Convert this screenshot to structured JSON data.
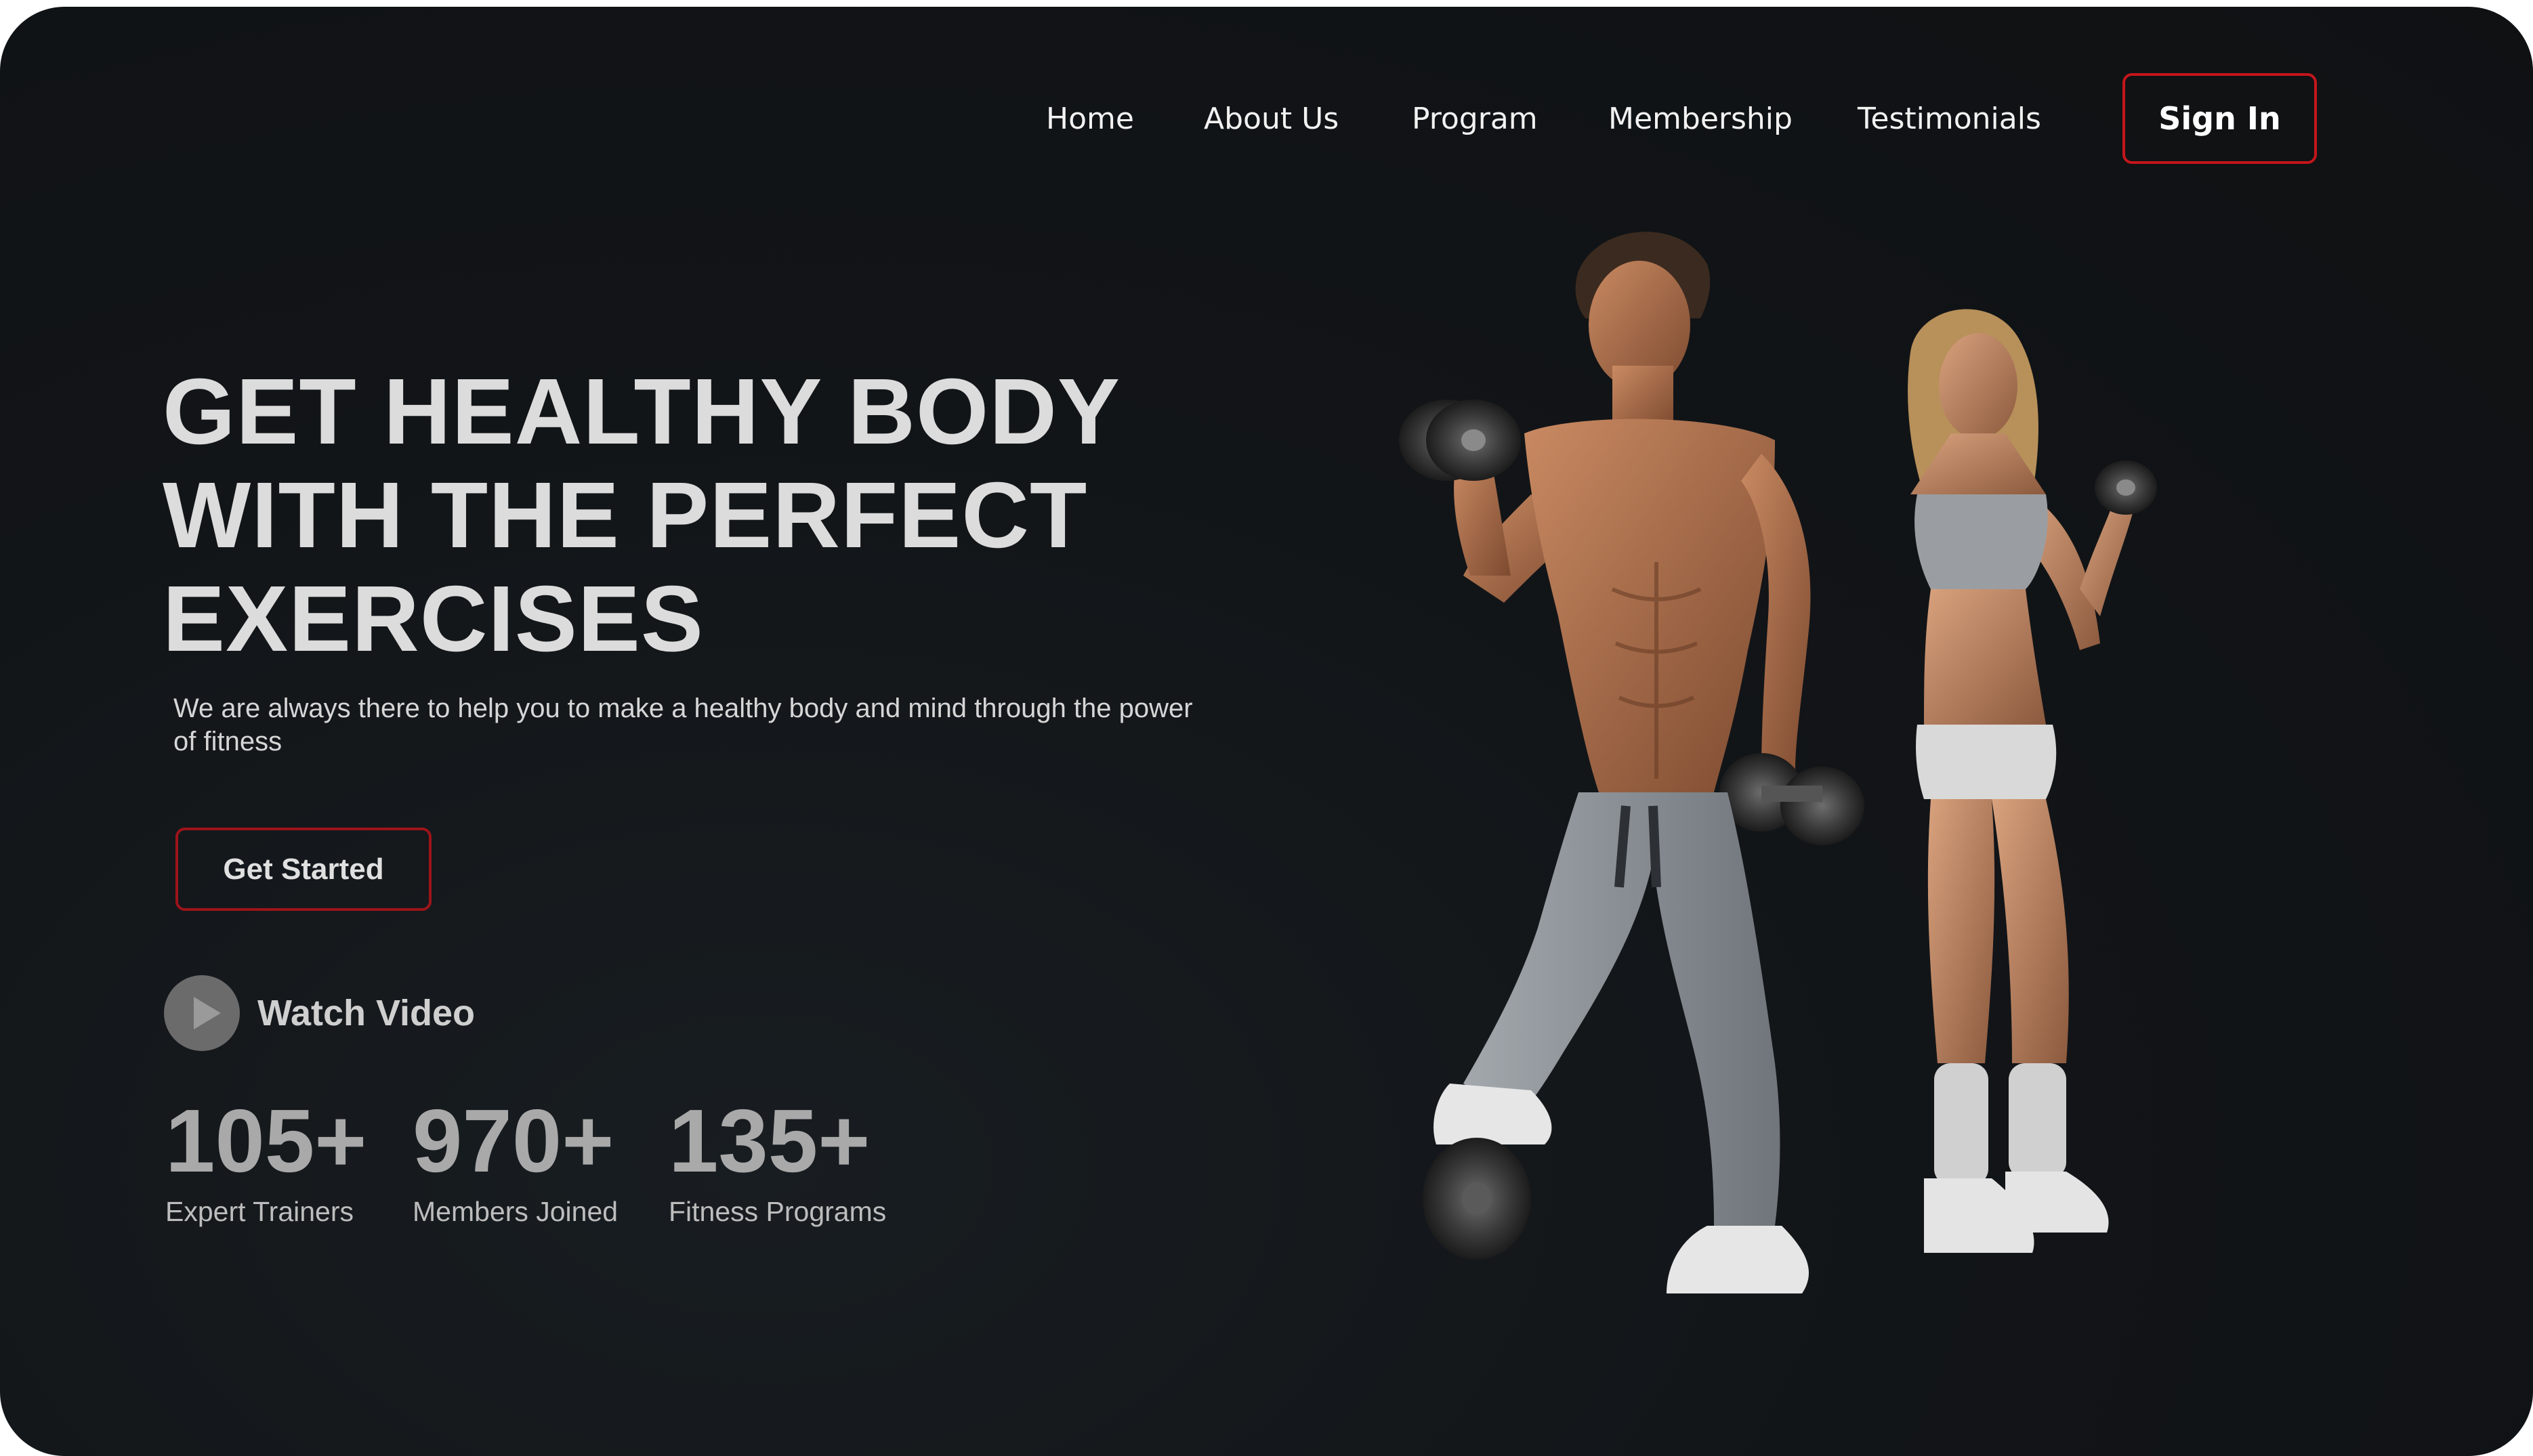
{
  "nav": {
    "links": [
      "Home",
      "About Us",
      "Program",
      "Membership",
      "Testimonials"
    ],
    "sign_in_label": "Sign In"
  },
  "hero": {
    "headline_lines": [
      "GET HEALTHY BODY",
      "WITH THE PERFECT",
      "EXERCISES"
    ],
    "subtext_lines": [
      "We are always there to help you to make a healthy body and mind through the power",
      "of fitness"
    ],
    "cta_label": "Get Started",
    "watch_video_label": "Watch Video"
  },
  "stats": [
    {
      "number": "105+",
      "label": "Expert Trainers"
    },
    {
      "number": "970+",
      "label": "Members Joined"
    },
    {
      "number": "135+",
      "label": "Fitness Programs"
    }
  ],
  "icons": {
    "play": "play-icon"
  },
  "colors": {
    "accent": "#c4161c",
    "background": "#121518",
    "text": "#dcdcdc"
  }
}
